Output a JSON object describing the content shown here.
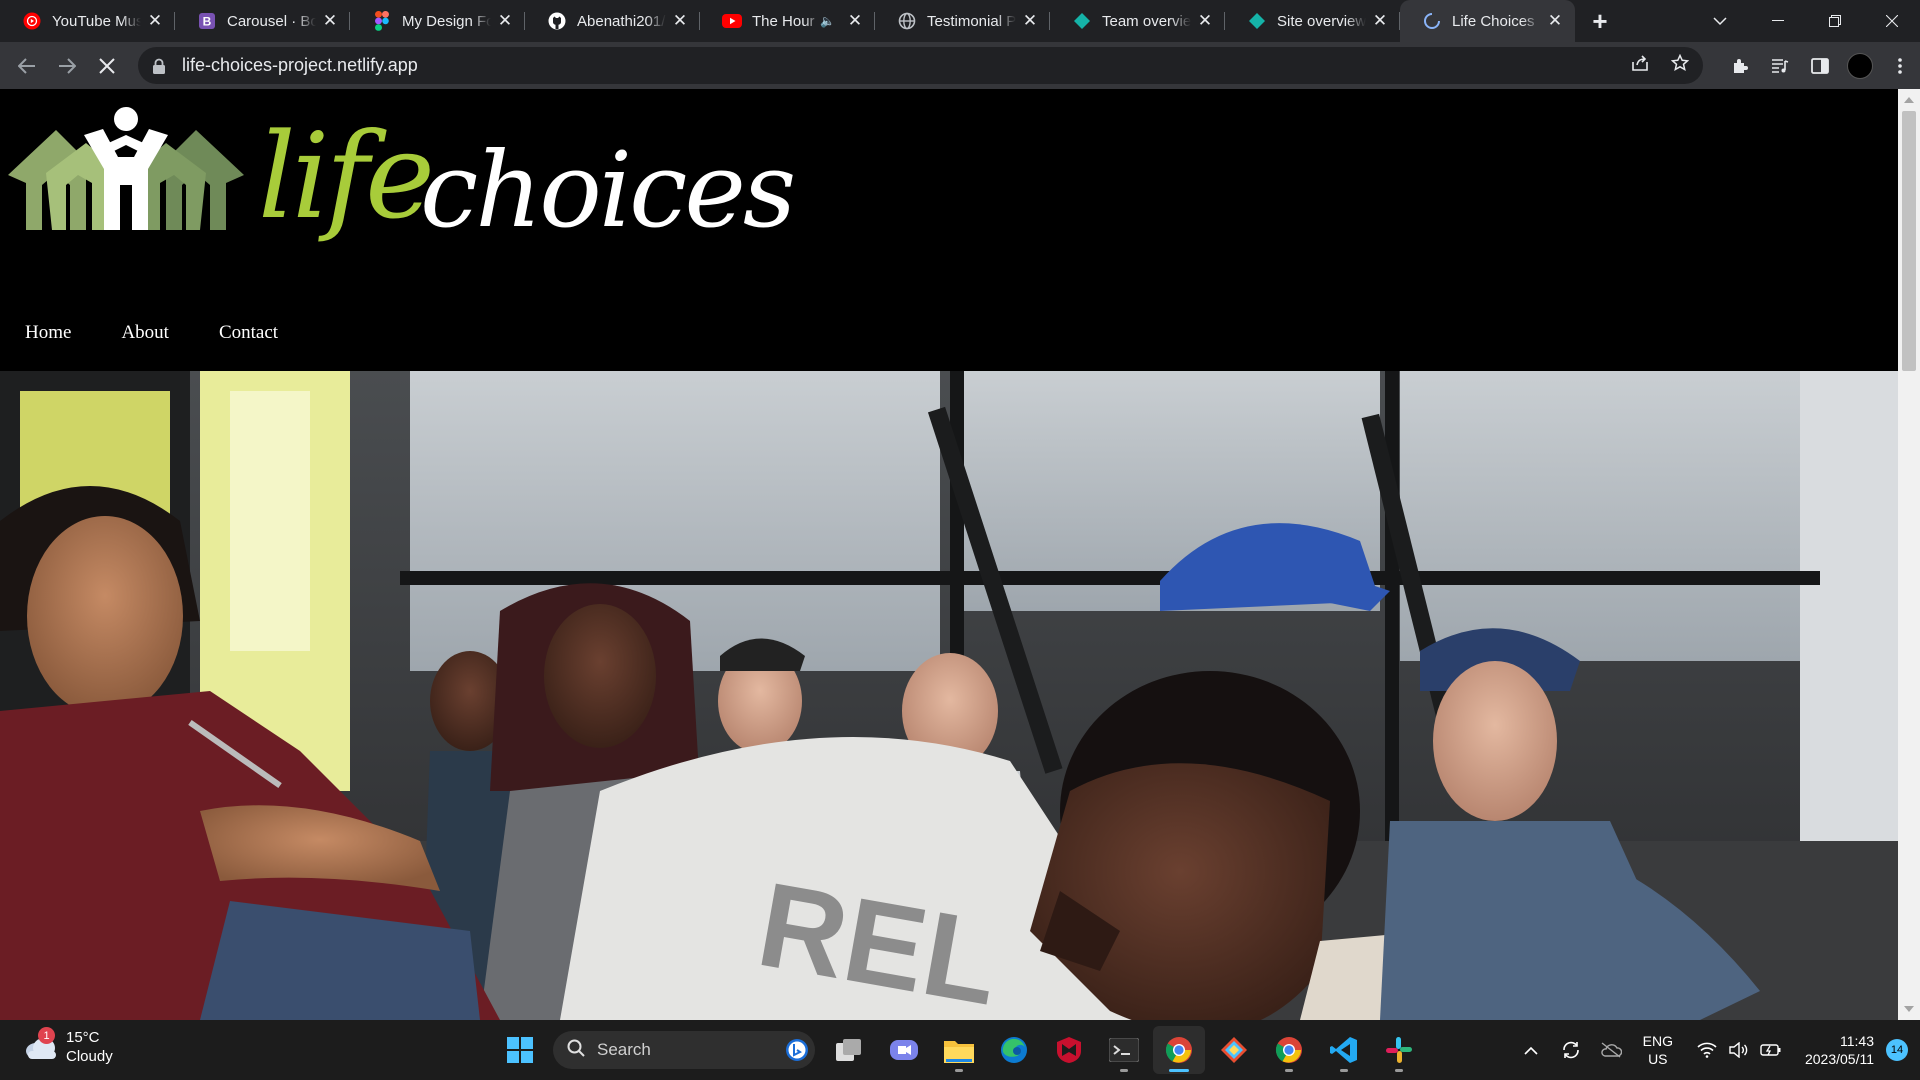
{
  "browser": {
    "tabs": [
      {
        "title": "YouTube Music",
        "icon": "youtube-music-icon",
        "active": false
      },
      {
        "title": "Carousel · Bootstrap",
        "icon": "bootstrap-icon",
        "active": false
      },
      {
        "title": "My Design For",
        "icon": "figma-icon",
        "active": false
      },
      {
        "title": "Abenathi201/",
        "icon": "github-icon",
        "active": false
      },
      {
        "title": "The Hour",
        "icon": "youtube-icon",
        "active": false,
        "muted": true
      },
      {
        "title": "Testimonial Pa",
        "icon": "globe-icon",
        "active": false
      },
      {
        "title": "Team overview",
        "icon": "netlify-icon",
        "active": false
      },
      {
        "title": "Site overview",
        "icon": "netlify-icon",
        "active": false
      },
      {
        "title": "Life Choices",
        "icon": "loading-spinner-icon",
        "active": true
      }
    ],
    "url": "life-choices-project.netlify.app"
  },
  "site": {
    "logo_life": "life",
    "logo_choices": "choices",
    "nav": [
      "Home",
      "About",
      "Contact"
    ],
    "colors": {
      "brand_green": "#a8cc3a",
      "background": "#000000"
    }
  },
  "taskbar": {
    "weather_temp": "15°C",
    "weather_desc": "Cloudy",
    "weather_badge": "1",
    "search_label": "Search",
    "lang_1": "ENG",
    "lang_2": "US",
    "time": "11:43",
    "date": "2023/05/11",
    "notification_count": "14"
  }
}
